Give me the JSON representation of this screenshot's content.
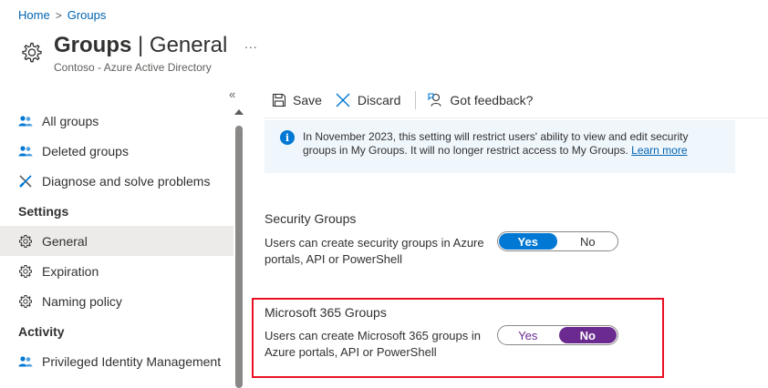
{
  "breadcrumb": {
    "home": "Home",
    "separator": ">",
    "current": "Groups"
  },
  "header": {
    "title_bold": "Groups",
    "title_rest": " | General",
    "subtitle": "Contoso - Azure Active Directory",
    "more": "...",
    "icon": "gear-icon"
  },
  "sidebar": {
    "collapse": "«",
    "items": [
      {
        "label": "All groups",
        "icon": "people-icon"
      },
      {
        "label": "Deleted groups",
        "icon": "people-icon"
      },
      {
        "label": "Diagnose and solve problems",
        "icon": "wrench-icon"
      }
    ],
    "settings_header": "Settings",
    "settings_items": [
      {
        "label": "General",
        "icon": "gear-icon",
        "selected": true
      },
      {
        "label": "Expiration",
        "icon": "gear-icon"
      },
      {
        "label": "Naming policy",
        "icon": "gear-icon"
      }
    ],
    "activity_header": "Activity",
    "activity_items": [
      {
        "label": "Privileged Identity Management",
        "icon": "people-icon"
      }
    ]
  },
  "toolbar": {
    "save": "Save",
    "discard": "Discard",
    "feedback": "Got feedback?"
  },
  "info": {
    "text": "In November 2023, this setting will restrict users' ability to view and edit security groups in My Groups. It will no longer restrict access to My Groups. ",
    "link": "Learn more"
  },
  "security_groups": {
    "title": "Security Groups",
    "description": "Users can create security groups in Azure portals, API or PowerShell",
    "yes": "Yes",
    "no": "No",
    "value": "Yes"
  },
  "m365_groups": {
    "title": "Microsoft 365 Groups",
    "description": "Users can create Microsoft 365 groups in Azure portals, API or PowerShell",
    "yes": "Yes",
    "no": "No",
    "value": "No"
  },
  "colors": {
    "accent": "#0078d4",
    "purple": "#6b2a8f",
    "highlight": "#e81123",
    "link": "#0063b1"
  }
}
